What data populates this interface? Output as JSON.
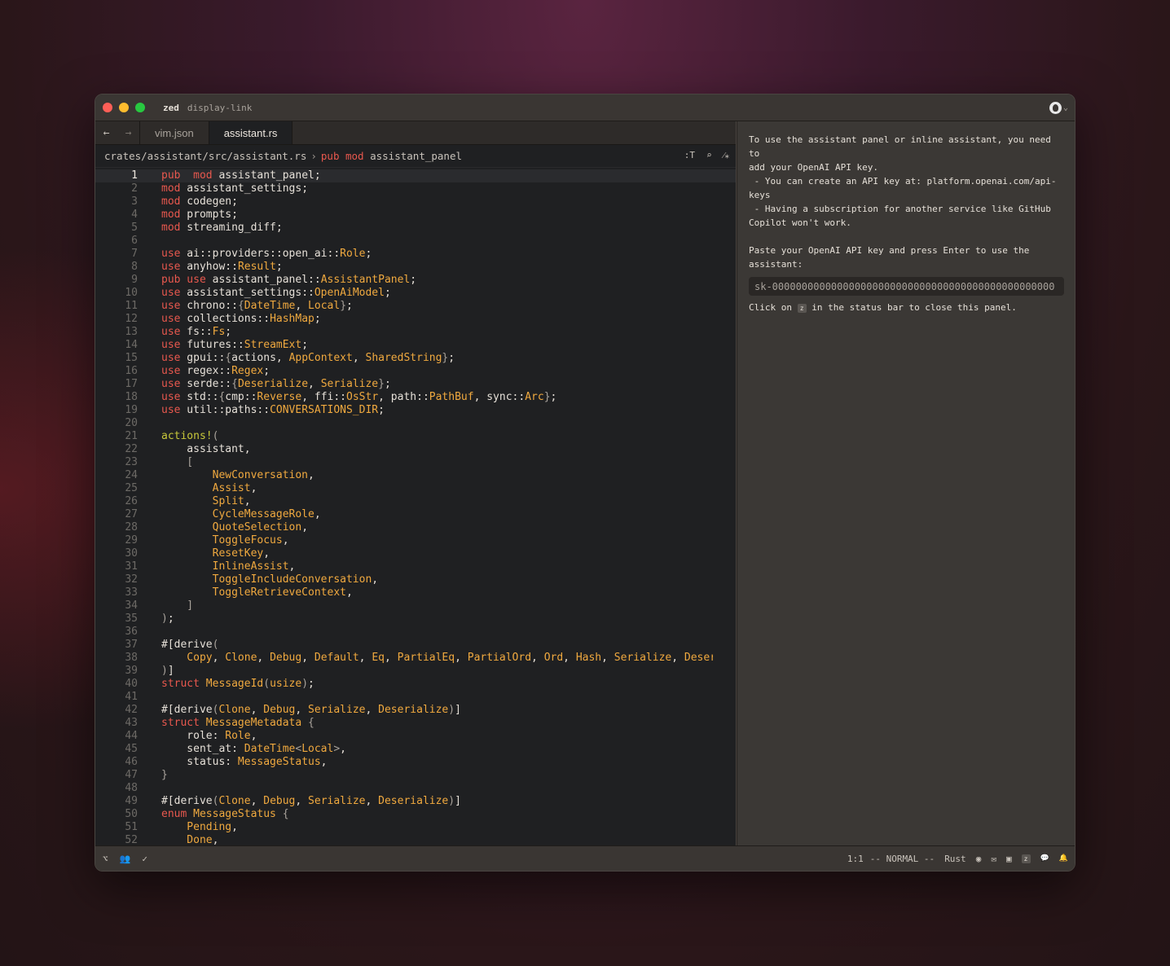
{
  "titlebar": {
    "project": "zed",
    "branch": "display-link"
  },
  "tabs": [
    {
      "label": "vim.json",
      "active": false
    },
    {
      "label": "assistant.rs",
      "active": true
    }
  ],
  "breadcrumb": {
    "path": "crates/assistant/src/assistant.rs",
    "sep": "›",
    "kw1": "pub",
    "kw2": "mod",
    "name": "assistant_panel"
  },
  "toolbar": {
    "symbol_label": ":T"
  },
  "code_lines": [
    [
      [
        "k",
        "pub"
      ],
      [
        "",
        "  "
      ],
      [
        "k",
        "mod"
      ],
      [
        "",
        " assistant_panel;"
      ]
    ],
    [
      [
        "k",
        "mod"
      ],
      [
        "",
        " assistant_settings;"
      ]
    ],
    [
      [
        "k",
        "mod"
      ],
      [
        "",
        " codegen;"
      ]
    ],
    [
      [
        "k",
        "mod"
      ],
      [
        "",
        " prompts;"
      ]
    ],
    [
      [
        "k",
        "mod"
      ],
      [
        "",
        " streaming_diff;"
      ]
    ],
    [],
    [
      [
        "k",
        "use"
      ],
      [
        "",
        " ai::providers::open_ai::"
      ],
      [
        "t",
        "Role"
      ],
      [
        "",
        ";"
      ]
    ],
    [
      [
        "k",
        "use"
      ],
      [
        "",
        " anyhow::"
      ],
      [
        "t",
        "Result"
      ],
      [
        "",
        ";"
      ]
    ],
    [
      [
        "k",
        "pub"
      ],
      [
        "",
        ""
      ],
      [
        "k",
        " use"
      ],
      [
        "",
        " assistant_panel::"
      ],
      [
        "t",
        "AssistantPanel"
      ],
      [
        "",
        ";"
      ]
    ],
    [
      [
        "k",
        "use"
      ],
      [
        "",
        " assistant_settings::"
      ],
      [
        "t",
        "OpenAiModel"
      ],
      [
        "",
        ";"
      ]
    ],
    [
      [
        "k",
        "use"
      ],
      [
        "",
        " chrono::"
      ],
      [
        "p",
        "{"
      ],
      [
        "t",
        "DateTime"
      ],
      [
        "",
        ", "
      ],
      [
        "t",
        "Local"
      ],
      [
        "p",
        "}"
      ],
      [
        "",
        ";"
      ]
    ],
    [
      [
        "k",
        "use"
      ],
      [
        "",
        " collections::"
      ],
      [
        "t",
        "HashMap"
      ],
      [
        "",
        ";"
      ]
    ],
    [
      [
        "k",
        "use"
      ],
      [
        "",
        " fs::"
      ],
      [
        "t",
        "Fs"
      ],
      [
        "",
        ";"
      ]
    ],
    [
      [
        "k",
        "use"
      ],
      [
        "",
        " futures::"
      ],
      [
        "t",
        "StreamExt"
      ],
      [
        "",
        ";"
      ]
    ],
    [
      [
        "k",
        "use"
      ],
      [
        "",
        " gpui::"
      ],
      [
        "p",
        "{"
      ],
      [
        "",
        "actions, "
      ],
      [
        "t",
        "AppContext"
      ],
      [
        "",
        ", "
      ],
      [
        "t",
        "SharedString"
      ],
      [
        "p",
        "}"
      ],
      [
        "",
        ";"
      ]
    ],
    [
      [
        "k",
        "use"
      ],
      [
        "",
        " regex::"
      ],
      [
        "t",
        "Regex"
      ],
      [
        "",
        ";"
      ]
    ],
    [
      [
        "k",
        "use"
      ],
      [
        "",
        " serde::"
      ],
      [
        "p",
        "{"
      ],
      [
        "t",
        "Deserialize"
      ],
      [
        "",
        ", "
      ],
      [
        "t",
        "Serialize"
      ],
      [
        "p",
        "}"
      ],
      [
        "",
        ";"
      ]
    ],
    [
      [
        "k",
        "use"
      ],
      [
        "",
        " std::"
      ],
      [
        "p",
        "{"
      ],
      [
        "",
        "cmp::"
      ],
      [
        "t",
        "Reverse"
      ],
      [
        "",
        ", ffi::"
      ],
      [
        "t",
        "OsStr"
      ],
      [
        "",
        ", path::"
      ],
      [
        "t",
        "PathBuf"
      ],
      [
        "",
        ", sync::"
      ],
      [
        "t",
        "Arc"
      ],
      [
        "p",
        "}"
      ],
      [
        "",
        ";"
      ]
    ],
    [
      [
        "k",
        "use"
      ],
      [
        "",
        " util::paths::"
      ],
      [
        "t",
        "CONVERSATIONS_DIR"
      ],
      [
        "",
        ";"
      ]
    ],
    [],
    [
      [
        "m",
        "actions!"
      ],
      [
        "p",
        "("
      ]
    ],
    [
      [
        "",
        "    assistant,"
      ]
    ],
    [
      [
        "p",
        "    ["
      ]
    ],
    [
      [
        "t",
        "        NewConversation"
      ],
      [
        "",
        ","
      ]
    ],
    [
      [
        "t",
        "        Assist"
      ],
      [
        "",
        ","
      ]
    ],
    [
      [
        "t",
        "        Split"
      ],
      [
        "",
        ","
      ]
    ],
    [
      [
        "t",
        "        CycleMessageRole"
      ],
      [
        "",
        ","
      ]
    ],
    [
      [
        "t",
        "        QuoteSelection"
      ],
      [
        "",
        ","
      ]
    ],
    [
      [
        "t",
        "        ToggleFocus"
      ],
      [
        "",
        ","
      ]
    ],
    [
      [
        "t",
        "        ResetKey"
      ],
      [
        "",
        ","
      ]
    ],
    [
      [
        "t",
        "        InlineAssist"
      ],
      [
        "",
        ","
      ]
    ],
    [
      [
        "t",
        "        ToggleIncludeConversation"
      ],
      [
        "",
        ","
      ]
    ],
    [
      [
        "t",
        "        ToggleRetrieveContext"
      ],
      [
        "",
        ","
      ]
    ],
    [
      [
        "p",
        "    ]"
      ]
    ],
    [
      [
        "p",
        ")"
      ],
      [
        "",
        ";"
      ]
    ],
    [],
    [
      [
        "",
        "#[derive"
      ],
      [
        "p",
        "("
      ]
    ],
    [
      [
        "t",
        "    Copy"
      ],
      [
        "",
        ", "
      ],
      [
        "t",
        "Clone"
      ],
      [
        "",
        ", "
      ],
      [
        "t",
        "Debug"
      ],
      [
        "",
        ", "
      ],
      [
        "t",
        "Default"
      ],
      [
        "",
        ", "
      ],
      [
        "t",
        "Eq"
      ],
      [
        "",
        ", "
      ],
      [
        "t",
        "PartialEq"
      ],
      [
        "",
        ", "
      ],
      [
        "t",
        "PartialOrd"
      ],
      [
        "",
        ", "
      ],
      [
        "t",
        "Ord"
      ],
      [
        "",
        ", "
      ],
      [
        "t",
        "Hash"
      ],
      [
        "",
        ", "
      ],
      [
        "t",
        "Serialize"
      ],
      [
        "",
        ", "
      ],
      [
        "t",
        "Deseriali"
      ]
    ],
    [
      [
        "p",
        ")"
      ],
      [
        "",
        "]"
      ]
    ],
    [
      [
        "k",
        "struct"
      ],
      [
        "t",
        " MessageId"
      ],
      [
        "p",
        "("
      ],
      [
        "t",
        "usize"
      ],
      [
        "p",
        ")"
      ],
      [
        "",
        ";"
      ]
    ],
    [],
    [
      [
        "",
        "#[derive"
      ],
      [
        "p",
        "("
      ],
      [
        "t",
        "Clone"
      ],
      [
        "",
        ", "
      ],
      [
        "t",
        "Debug"
      ],
      [
        "",
        ", "
      ],
      [
        "t",
        "Serialize"
      ],
      [
        "",
        ", "
      ],
      [
        "t",
        "Deserialize"
      ],
      [
        "p",
        ")"
      ],
      [
        "",
        "]"
      ]
    ],
    [
      [
        "k",
        "struct"
      ],
      [
        "t",
        " MessageMetadata"
      ],
      [
        "p",
        " {"
      ]
    ],
    [
      [
        "",
        "    role: "
      ],
      [
        "t",
        "Role"
      ],
      [
        "",
        ","
      ]
    ],
    [
      [
        "",
        "    sent_at: "
      ],
      [
        "t",
        "DateTime"
      ],
      [
        "p",
        "<"
      ],
      [
        "t",
        "Local"
      ],
      [
        "p",
        ">"
      ],
      [
        "",
        ","
      ]
    ],
    [
      [
        "",
        "    status: "
      ],
      [
        "t",
        "MessageStatus"
      ],
      [
        "",
        ","
      ]
    ],
    [
      [
        "p",
        "}"
      ]
    ],
    [],
    [
      [
        "",
        "#[derive"
      ],
      [
        "p",
        "("
      ],
      [
        "t",
        "Clone"
      ],
      [
        "",
        ", "
      ],
      [
        "t",
        "Debug"
      ],
      [
        "",
        ", "
      ],
      [
        "t",
        "Serialize"
      ],
      [
        "",
        ", "
      ],
      [
        "t",
        "Deserialize"
      ],
      [
        "p",
        ")"
      ],
      [
        "",
        "]"
      ]
    ],
    [
      [
        "k",
        "enum"
      ],
      [
        "t",
        " MessageStatus"
      ],
      [
        "p",
        " {"
      ]
    ],
    [
      [
        "t",
        "    Pending"
      ],
      [
        "",
        ","
      ]
    ],
    [
      [
        "t",
        "    Done"
      ],
      [
        "",
        ","
      ]
    ]
  ],
  "assistant_panel": {
    "intro": "To use the assistant panel or inline assistant, you need to\nadd your OpenAI API key.\n - You can create an API key at: platform.openai.com/api-keys\n - Having a subscription for another service like GitHub\nCopilot won't work.",
    "paste_prompt": "Paste your OpenAI API key and press Enter to use the\nassistant:",
    "key_placeholder": "sk-000000000000000000000000000000000000000000000000",
    "close_hint_before": "Click on",
    "close_hint_icon": "z",
    "close_hint_after": "in the status bar to close this panel."
  },
  "statusbar": {
    "cursor": "1:1",
    "mode": "-- NORMAL --",
    "language": "Rust"
  },
  "icons": {
    "project-tree": "⌥",
    "collab": "👥",
    "diagnostics": "✓",
    "copilot": "◉",
    "feedback": "✉",
    "terminal": "▣",
    "assistant": "z",
    "chat": "💬",
    "notifications": "🔔"
  }
}
